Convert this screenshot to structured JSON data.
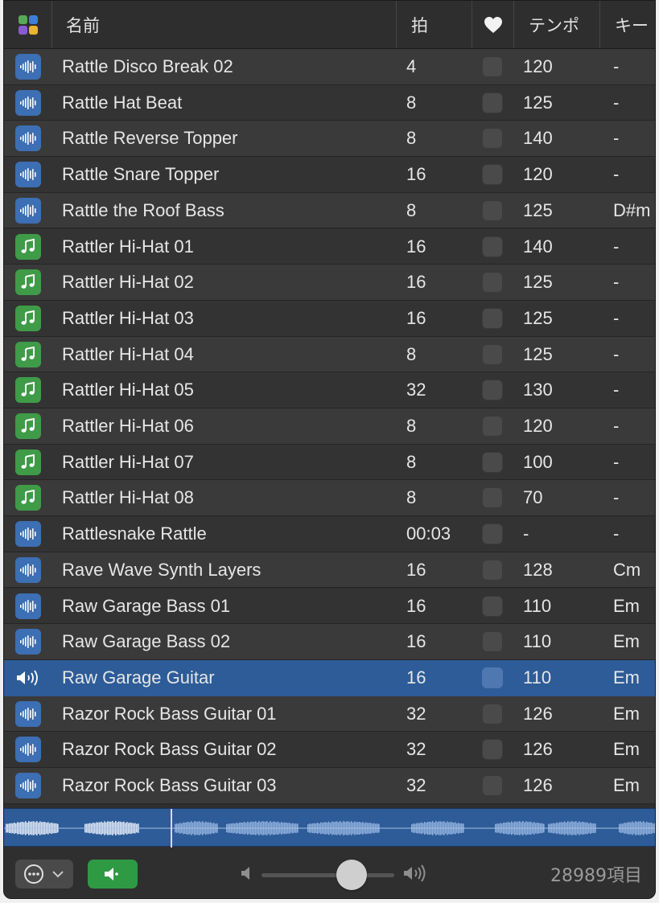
{
  "header": {
    "icon": "color-grid-icon",
    "name": "名前",
    "beats": "拍",
    "favorite_icon": "heart-icon",
    "tempo": "テンポ",
    "key": "キー"
  },
  "rows": [
    {
      "name": "Rattle Disco Break 02",
      "beats": "4",
      "tempo": "120",
      "key": "-",
      "type": "audio"
    },
    {
      "name": "Rattle Hat Beat",
      "beats": "8",
      "tempo": "125",
      "key": "-",
      "type": "audio"
    },
    {
      "name": "Rattle Reverse Topper",
      "beats": "8",
      "tempo": "140",
      "key": "-",
      "type": "audio"
    },
    {
      "name": "Rattle Snare Topper",
      "beats": "16",
      "tempo": "120",
      "key": "-",
      "type": "audio"
    },
    {
      "name": "Rattle the Roof Bass",
      "beats": "8",
      "tempo": "125",
      "key": "D#m",
      "type": "audio"
    },
    {
      "name": "Rattler Hi-Hat 01",
      "beats": "16",
      "tempo": "140",
      "key": "-",
      "type": "midi"
    },
    {
      "name": "Rattler Hi-Hat 02",
      "beats": "16",
      "tempo": "125",
      "key": "-",
      "type": "midi"
    },
    {
      "name": "Rattler Hi-Hat 03",
      "beats": "16",
      "tempo": "125",
      "key": "-",
      "type": "midi"
    },
    {
      "name": "Rattler Hi-Hat 04",
      "beats": "8",
      "tempo": "125",
      "key": "-",
      "type": "midi"
    },
    {
      "name": "Rattler Hi-Hat 05",
      "beats": "32",
      "tempo": "130",
      "key": "-",
      "type": "midi"
    },
    {
      "name": "Rattler Hi-Hat 06",
      "beats": "8",
      "tempo": "120",
      "key": "-",
      "type": "midi"
    },
    {
      "name": "Rattler Hi-Hat 07",
      "beats": "8",
      "tempo": "100",
      "key": "-",
      "type": "midi"
    },
    {
      "name": "Rattler Hi-Hat 08",
      "beats": "8",
      "tempo": "70",
      "key": "-",
      "type": "midi"
    },
    {
      "name": "Rattlesnake Rattle",
      "beats": "00:03",
      "tempo": "-",
      "key": "-",
      "type": "audio"
    },
    {
      "name": "Rave Wave Synth Layers",
      "beats": "16",
      "tempo": "128",
      "key": "Cm",
      "type": "audio"
    },
    {
      "name": "Raw Garage Bass 01",
      "beats": "16",
      "tempo": "110",
      "key": "Em",
      "type": "audio"
    },
    {
      "name": "Raw Garage Bass 02",
      "beats": "16",
      "tempo": "110",
      "key": "Em",
      "type": "audio"
    },
    {
      "name": "Raw Garage Guitar",
      "beats": "16",
      "tempo": "110",
      "key": "Em",
      "type": "playing",
      "selected": true
    },
    {
      "name": "Razor Rock Bass Guitar 01",
      "beats": "32",
      "tempo": "126",
      "key": "Em",
      "type": "audio"
    },
    {
      "name": "Razor Rock Bass Guitar 02",
      "beats": "32",
      "tempo": "126",
      "key": "Em",
      "type": "audio"
    },
    {
      "name": "Razor Rock Bass Guitar 03",
      "beats": "32",
      "tempo": "126",
      "key": "Em",
      "type": "audio"
    }
  ],
  "player": {
    "playhead_fraction": 0.255,
    "volume_fraction": 0.68
  },
  "footer": {
    "more_icon": "ellipsis-circle-icon",
    "preview_icon": "speaker-icon",
    "item_count": "28989項目"
  },
  "colors": {
    "selection": "#2d5c98",
    "audio_icon": "#3c6fb3",
    "midi_icon": "#3f9b48",
    "preview_button": "#2f9a44"
  }
}
